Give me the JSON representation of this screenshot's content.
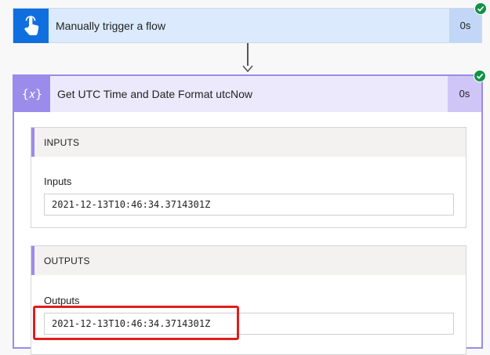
{
  "trigger": {
    "title": "Manually trigger a flow",
    "duration": "0s",
    "icon": "touch-hand-icon",
    "status": "succeeded"
  },
  "action": {
    "title": "Get UTC Time and Date Format utcNow",
    "duration": "0s",
    "icon": "expression-braces-icon",
    "icon_text": "{𝑥}",
    "status": "succeeded",
    "inputs": {
      "header": "INPUTS",
      "label": "Inputs",
      "value": "2021-12-13T10:46:34.3714301Z"
    },
    "outputs": {
      "header": "OUTPUTS",
      "label": "Outputs",
      "value": "2021-12-13T10:46:34.3714301Z"
    }
  },
  "colors": {
    "trigger_accent": "#0f6fde",
    "action_accent": "#9b8bea",
    "success": "#129245",
    "highlight": "#e01e1e"
  }
}
